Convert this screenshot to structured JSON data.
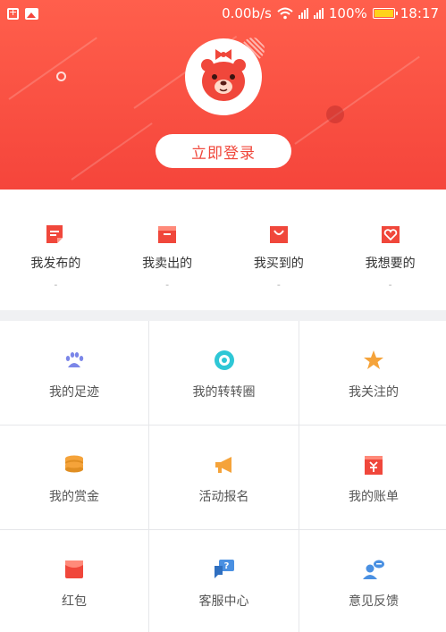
{
  "status_bar": {
    "network_speed": "0.00b/s",
    "battery_percent": "100%",
    "battery_level": 1.0,
    "time": "18:17"
  },
  "header": {
    "login_label": "立即登录",
    "accent": "#f5453b"
  },
  "stats": [
    {
      "label": "我发布的",
      "count": "-",
      "icon": "post-icon"
    },
    {
      "label": "我卖出的",
      "count": "-",
      "icon": "sold-box-icon"
    },
    {
      "label": "我买到的",
      "count": "-",
      "icon": "bought-bag-icon"
    },
    {
      "label": "我想要的",
      "count": "-",
      "icon": "want-heart-icon"
    }
  ],
  "grid": [
    {
      "label": "我的足迹",
      "icon": "paw-icon",
      "color": "#7b86e8"
    },
    {
      "label": "我的转转圈",
      "icon": "circle-icon",
      "color": "#2ec7d6"
    },
    {
      "label": "我关注的",
      "icon": "star-icon",
      "color": "#f5a33a"
    },
    {
      "label": "我的赏金",
      "icon": "coins-icon",
      "color": "#f5a33a"
    },
    {
      "label": "活动报名",
      "icon": "megaphone-icon",
      "color": "#f5a33a"
    },
    {
      "label": "我的账单",
      "icon": "bill-icon",
      "color": "#f0473b"
    },
    {
      "label": "红包",
      "icon": "red-packet-icon",
      "color": "#f0473b"
    },
    {
      "label": "客服中心",
      "icon": "support-chat-icon",
      "color": "#4a90e2"
    },
    {
      "label": "意见反馈",
      "icon": "feedback-icon",
      "color": "#4a90e2"
    }
  ]
}
